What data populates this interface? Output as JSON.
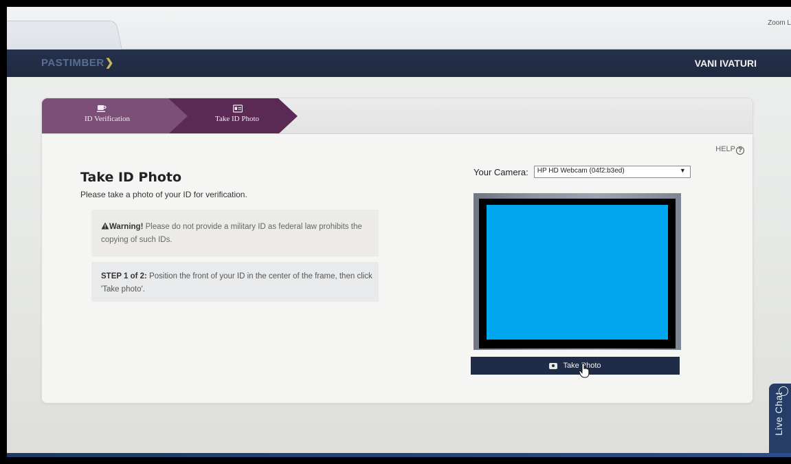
{
  "browser": {
    "zoom_label": "Zoom L"
  },
  "header": {
    "logo_text": "PASTIMBER",
    "user_name": "VANI IVATURI"
  },
  "wizard": {
    "steps": [
      {
        "label": "ID Verification",
        "icon": "coffee-cup-icon",
        "active": false
      },
      {
        "label": "Take ID Photo",
        "icon": "id-card-icon",
        "active": true
      }
    ],
    "help_label": "HELP"
  },
  "main": {
    "title": "Take ID Photo",
    "subtitle": "Please take a photo of your ID for verification.",
    "warning": {
      "strong": "Warning!",
      "text": " Please do not provide a military ID as federal law prohibits the copying of such IDs."
    },
    "step_info": {
      "strong": "STEP 1 of 2:",
      "text": " Position the front of your ID in the center of the frame, then click 'Take photo'."
    }
  },
  "camera": {
    "label": "Your Camera:",
    "selected": "HP HD Webcam (04f2:b3ed)",
    "preview_color": "#00a6ee"
  },
  "actions": {
    "take_photo_label": "Take Photo"
  },
  "live_chat": {
    "label": "Live Chat"
  },
  "colors": {
    "header": "#1f2a42",
    "step_inactive": "#7b4f78",
    "step_active": "#5a2a55",
    "button": "#1f2c48"
  }
}
